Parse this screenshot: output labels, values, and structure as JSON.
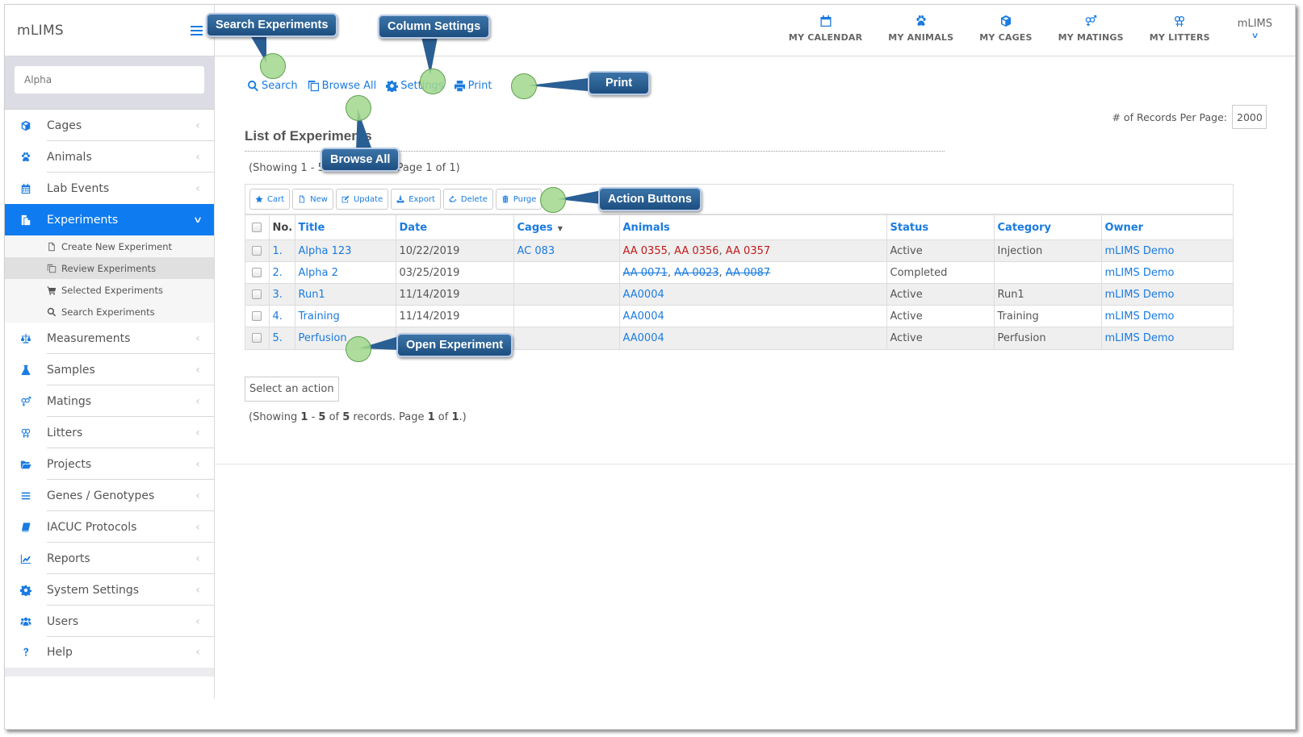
{
  "app": {
    "brand": "mLIMS",
    "user": "mLIMS"
  },
  "sidebar": {
    "search": {
      "value": "",
      "placeholder": "Alpha"
    },
    "items": [
      {
        "label": "Cages",
        "icon": "cube-icon"
      },
      {
        "label": "Animals",
        "icon": "paw-icon"
      },
      {
        "label": "Lab Events",
        "icon": "calendar-icon"
      },
      {
        "label": "Experiments",
        "icon": "experiments-icon",
        "active": true
      },
      {
        "label": "Measurements",
        "icon": "balance-scale-icon"
      },
      {
        "label": "Samples",
        "icon": "flask-icon"
      },
      {
        "label": "Matings",
        "icon": "mating-icon"
      },
      {
        "label": "Litters",
        "icon": "litter-icon"
      },
      {
        "label": "Projects",
        "icon": "folder-open-icon"
      },
      {
        "label": "Genes / Genotypes",
        "icon": "list-icon"
      },
      {
        "label": "IACUC Protocols",
        "icon": "book-icon"
      },
      {
        "label": "Reports",
        "icon": "line-chart-icon"
      },
      {
        "label": "System Settings",
        "icon": "gear-icon"
      },
      {
        "label": "Users",
        "icon": "users-icon"
      },
      {
        "label": "Help",
        "icon": "question-icon"
      }
    ],
    "experiments_sub": [
      {
        "label": "Create New Experiment",
        "icon": "file-icon"
      },
      {
        "label": "Review Experiments",
        "icon": "copy-icon",
        "selected": true
      },
      {
        "label": "Selected Experiments",
        "icon": "cart-icon"
      },
      {
        "label": "Search Experiments",
        "icon": "search-icon"
      }
    ]
  },
  "topnav": [
    {
      "label": "MY CALENDAR",
      "icon": "calendar-icon"
    },
    {
      "label": "MY ANIMALS",
      "icon": "paw-icon"
    },
    {
      "label": "MY CAGES",
      "icon": "cube-icon"
    },
    {
      "label": "MY MATINGS",
      "icon": "mating-icon"
    },
    {
      "label": "MY LITTERS",
      "icon": "litter-icon"
    }
  ],
  "toolbar": {
    "search": "Search",
    "browse_all": "Browse All",
    "settings": "Settings",
    "print": "Print"
  },
  "records_per_page": {
    "label": "# of Records Per Page:",
    "value": "2000"
  },
  "list": {
    "title": "List of Experiments",
    "showing_top": "(Showing 1 - 5 of 5 records. Page 1 of 1)",
    "showing_bottom": {
      "prefix": "(Showing ",
      "from": "1",
      "sep1": " - ",
      "to": "5",
      "sep2": " of ",
      "total": "5",
      "sep3": " records. Page ",
      "page": "1",
      "sep4": " of ",
      "pages": "1",
      "suffix": ".)"
    },
    "select_action": "Select an action"
  },
  "actions": [
    {
      "label": "Cart",
      "icon": "star-icon"
    },
    {
      "label": "New",
      "icon": "file-icon"
    },
    {
      "label": "Update",
      "icon": "edit-icon"
    },
    {
      "label": "Export",
      "icon": "download-icon"
    },
    {
      "label": "Delete",
      "icon": "recycle-icon"
    },
    {
      "label": "Purge",
      "icon": "trash-icon"
    }
  ],
  "table": {
    "columns": [
      "No.",
      "Title",
      "Date",
      "Cages",
      "Animals",
      "Status",
      "Category",
      "Owner"
    ],
    "sorted_column": "Cages",
    "rows": [
      {
        "no": "1.",
        "title": "Alpha 123",
        "date": "10/22/2019",
        "cages": "AC 083",
        "animals": [
          {
            "id": "AA 0355",
            "style": "red"
          },
          {
            "id": "AA 0356",
            "style": "red"
          },
          {
            "id": "AA 0357",
            "style": "red"
          }
        ],
        "status": "Active",
        "category": "Injection",
        "owner": "mLIMS Demo"
      },
      {
        "no": "2.",
        "title": "Alpha 2",
        "date": "03/25/2019",
        "cages": "",
        "animals": [
          {
            "id": "AA 0071",
            "style": "strike"
          },
          {
            "id": "AA 0023",
            "style": "strike"
          },
          {
            "id": "AA 0087",
            "style": "strike"
          }
        ],
        "status": "Completed",
        "category": "",
        "owner": "mLIMS Demo"
      },
      {
        "no": "3.",
        "title": "Run1",
        "date": "11/14/2019",
        "cages": "",
        "animals": [
          {
            "id": "AA0004",
            "style": "link"
          }
        ],
        "status": "Active",
        "category": "Run1",
        "owner": "mLIMS Demo"
      },
      {
        "no": "4.",
        "title": "Training",
        "date": "11/14/2019",
        "cages": "",
        "animals": [
          {
            "id": "AA0004",
            "style": "link"
          }
        ],
        "status": "Active",
        "category": "Training",
        "owner": "mLIMS Demo"
      },
      {
        "no": "5.",
        "title": "Perfusion",
        "date": "",
        "cages": "",
        "animals": [
          {
            "id": "AA0004",
            "style": "link"
          }
        ],
        "status": "Active",
        "category": "Perfusion",
        "owner": "mLIMS Demo"
      }
    ]
  },
  "callouts": {
    "search_experiments": "Search Experiments",
    "column_settings": "Column Settings",
    "print": "Print",
    "browse_all": "Browse All",
    "action_buttons": "Action Buttons",
    "open_experiment": "Open Experiment"
  },
  "colors": {
    "accent": "#1a7be0",
    "active_nav": "#0f7bf0",
    "animal_alert": "#c21a1a",
    "callout": "#2a5f94",
    "callout_dot": "#a0d78c"
  }
}
